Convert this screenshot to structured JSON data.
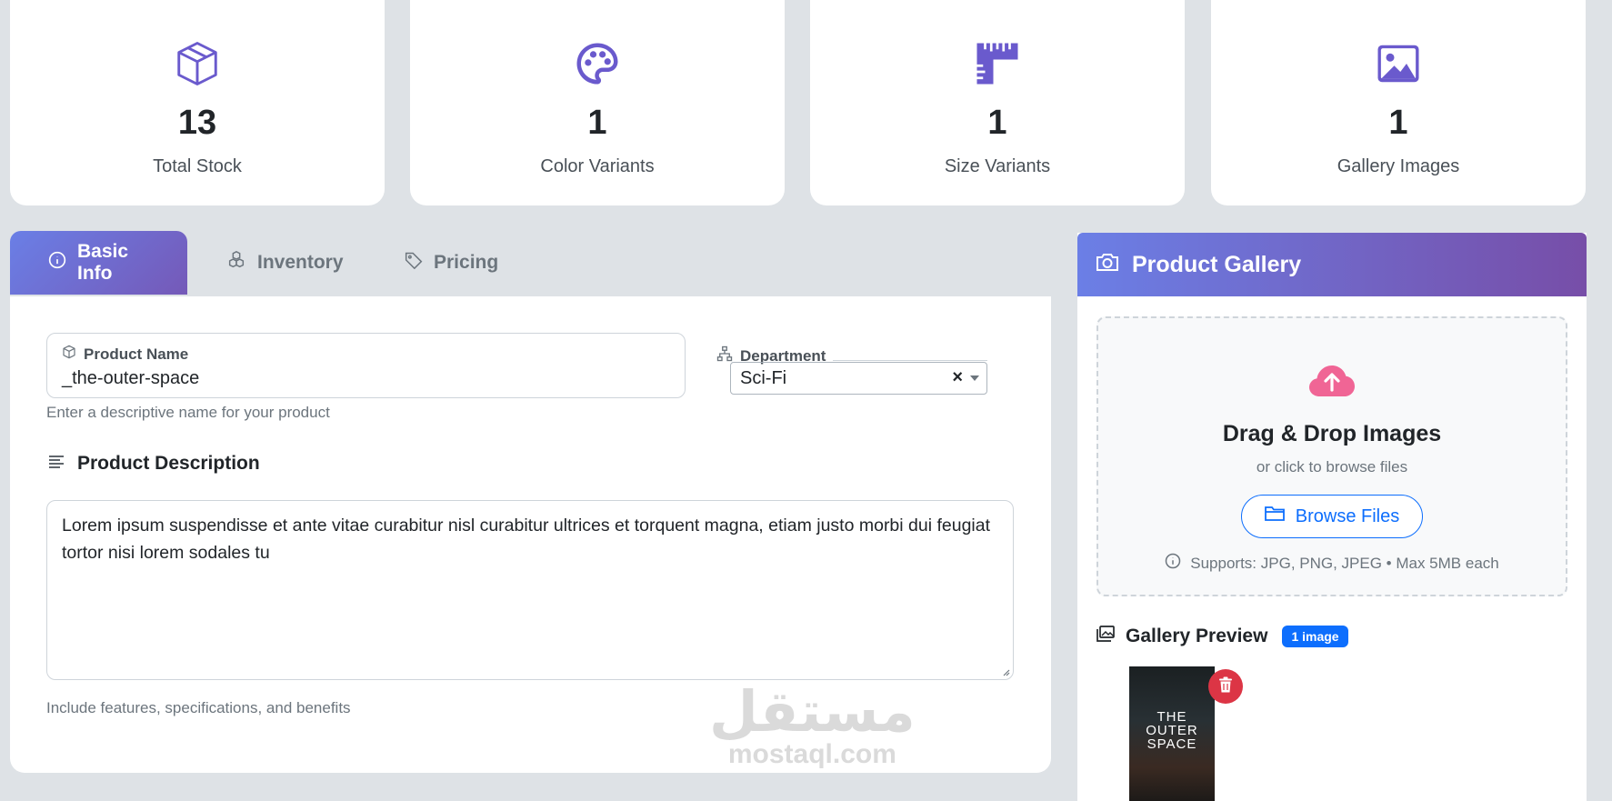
{
  "stats": [
    {
      "icon": "box-icon",
      "value": "13",
      "label": "Total Stock"
    },
    {
      "icon": "palette-icon",
      "value": "1",
      "label": "Color Variants"
    },
    {
      "icon": "ruler-icon",
      "value": "1",
      "label": "Size Variants"
    },
    {
      "icon": "image-icon",
      "value": "1",
      "label": "Gallery Images"
    }
  ],
  "tabs": [
    {
      "label": "Basic Info",
      "icon": "info-circle-icon",
      "active": true
    },
    {
      "label": "Inventory",
      "icon": "boxes-icon",
      "active": false
    },
    {
      "label": "Pricing",
      "icon": "tag-icon",
      "active": false
    }
  ],
  "form": {
    "product_name": {
      "label": "Product Name",
      "value": "_the-outer-space",
      "hint": "Enter a descriptive name for your product"
    },
    "department": {
      "label": "Department",
      "value": "Sci-Fi",
      "clear": "×"
    },
    "description": {
      "label": "Product Description",
      "value": "Lorem ipsum suspendisse et ante vitae curabitur nisl curabitur ultrices et torquent magna, etiam justo morbi dui feugiat tortor nisi lorem sodales tu",
      "hint": "Include features, specifications, and benefits"
    }
  },
  "gallery": {
    "title": "Product Gallery",
    "dropzone": {
      "title": "Drag & Drop Images",
      "subtitle": "or click to browse files",
      "button": "Browse Files",
      "note": "Supports: JPG, PNG, JPEG • Max 5MB each"
    },
    "preview": {
      "title": "Gallery Preview",
      "badge": "1 image",
      "thumb_title": "THE\nOUTER\nSPACE"
    }
  },
  "colors": {
    "accent_start": "#6a7fe6",
    "accent_end": "#774ea8",
    "primary": "#0d6efd",
    "danger": "#dc3545",
    "upload_icon": "#f06595",
    "stat_icon": "#6a5acd"
  },
  "watermark": {
    "arabic": "مستقل",
    "latin": "mostaql.com"
  }
}
